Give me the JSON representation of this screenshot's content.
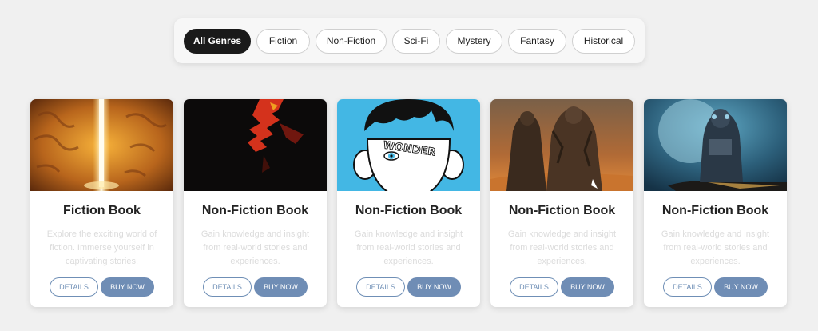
{
  "genres": [
    {
      "label": "All Genres",
      "active": true
    },
    {
      "label": "Fiction",
      "active": false
    },
    {
      "label": "Non-Fiction",
      "active": false
    },
    {
      "label": "Sci-Fi",
      "active": false
    },
    {
      "label": "Mystery",
      "active": false
    },
    {
      "label": "Fantasy",
      "active": false
    },
    {
      "label": "Historical",
      "active": false
    }
  ],
  "books": [
    {
      "title": "Fiction Book",
      "description": "Explore the exciting world of fiction. Immerse yourself in captivating stories.",
      "details_label": "DETAILS",
      "buy_label": "BUY NOW",
      "cover": "glowing-cave-cover"
    },
    {
      "title": "Non-Fiction Book",
      "description": "Gain knowledge and insight from real-world stories and experiences.",
      "details_label": "DETAILS",
      "buy_label": "BUY NOW",
      "cover": "dark-red-abstract-cover"
    },
    {
      "title": "Non-Fiction Book",
      "description": "Gain knowledge and insight from real-world stories and experiences.",
      "details_label": "DETAILS",
      "buy_label": "BUY NOW",
      "cover": "wonder-face-cover",
      "cover_text": "WONDER"
    },
    {
      "title": "Non-Fiction Book",
      "description": "Gain knowledge and insight from real-world stories and experiences.",
      "details_label": "DETAILS",
      "buy_label": "BUY NOW",
      "cover": "desert-warriors-cover"
    },
    {
      "title": "Non-Fiction Book",
      "description": "Gain knowledge and insight from real-world stories and experiences.",
      "details_label": "DETAILS",
      "buy_label": "BUY NOW",
      "cover": "astronaut-moon-cover"
    }
  ],
  "colors": {
    "accent": "#6f8db5",
    "active_pill": "#1a1a1a",
    "background": "#f0f0f0"
  }
}
